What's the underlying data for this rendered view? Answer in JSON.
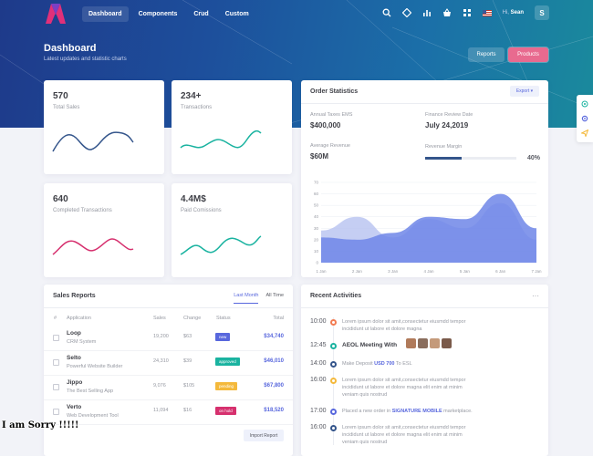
{
  "nav": {
    "items": [
      {
        "label": "Dashboard",
        "active": true
      },
      {
        "label": "Components",
        "active": false
      },
      {
        "label": "Crud",
        "active": false
      },
      {
        "label": "Custom",
        "active": false
      }
    ],
    "greeting": "Hi,",
    "user_name": "Sean",
    "user_initial": "S",
    "icons": [
      "search-icon",
      "diamond-icon",
      "bar-chart-icon",
      "basket-icon",
      "flag-icon"
    ]
  },
  "header": {
    "title": "Dashboard",
    "subtitle": "Latest updates and statistic charts",
    "reports_label": "Reports",
    "products_label": "Products"
  },
  "stats": [
    {
      "value": "570",
      "label": "Total Sales",
      "color": "#34558b"
    },
    {
      "value": "234+",
      "label": "Transactions",
      "color": "#1ab3a0"
    },
    {
      "value": "640",
      "label": "Completed Transactions",
      "color": "#d6306e"
    },
    {
      "value": "4.4M$",
      "label": "Paid Comissions",
      "color": "#1ab3a0"
    }
  ],
  "order_stats": {
    "title": "Order Statistics",
    "export_label": "Export",
    "annual_taxes_label": "Annual Taxes EMS",
    "annual_taxes_value": "$400,000",
    "finance_review_label": "Finance Review Date",
    "finance_review_value": "July 24,2019",
    "avg_revenue_label": "Average Revenue",
    "avg_revenue_value": "$60M",
    "revenue_margin_label": "Revenue Margin",
    "revenue_margin_value": "40%",
    "revenue_margin_fraction": 0.4
  },
  "chart_data": {
    "type": "area",
    "x": [
      "1 Jan",
      "2 Jan",
      "3 Jan",
      "4 Jan",
      "5 Jan",
      "6 Jan",
      "7 Jan"
    ],
    "yticks": [
      0,
      10,
      20,
      30,
      40,
      50,
      60,
      70
    ],
    "ylim": [
      0,
      70
    ],
    "series": [
      {
        "values": [
          28,
          40,
          22,
          38,
          30,
          52,
          20
        ],
        "color": "#b7c2f0"
      },
      {
        "values": [
          22,
          20,
          26,
          40,
          38,
          60,
          30
        ],
        "color": "#6f86e8"
      }
    ],
    "grid": true
  },
  "sales_reports": {
    "title": "Sales Reports",
    "tabs": [
      {
        "label": "Last Month",
        "active": true
      },
      {
        "label": "All Time",
        "active": false
      }
    ],
    "columns": [
      "#",
      "Application",
      "Sales",
      "Change",
      "Status",
      "Total"
    ],
    "rows": [
      {
        "name": "Loop",
        "desc": "CRM System",
        "sales": "19,200",
        "change": "$63",
        "status": "new",
        "status_color": "#5867dd",
        "total": "$34,740"
      },
      {
        "name": "Selto",
        "desc": "Powerful Website Builder",
        "sales": "24,310",
        "change": "$39",
        "status": "approved",
        "status_color": "#1ab3a0",
        "total": "$46,010"
      },
      {
        "name": "Jippo",
        "desc": "The Best Selling App",
        "sales": "9,076",
        "change": "$105",
        "status": "pending",
        "status_color": "#f4b93c",
        "total": "$67,800"
      },
      {
        "name": "Verto",
        "desc": "Web Development Tool",
        "sales": "11,094",
        "change": "$16",
        "status": "on hold",
        "status_color": "#d6306e",
        "total": "$18,520"
      }
    ],
    "import_label": "Import Report"
  },
  "activities": {
    "title": "Recent Activities",
    "items": [
      {
        "time": "10:00",
        "dot": "#f27c52",
        "text": "Lorem ipsum dolor sit amit,consectetur eiusmdd tempor incididunt ut labore et dolore magna"
      },
      {
        "time": "12:45",
        "dot": "#1ab3a0",
        "text": "AEOL Meeting With"
      },
      {
        "time": "14:00",
        "dot": "#34558b",
        "text_before": "Make Deposit ",
        "text_amount": "USD 700",
        "text_after": " To ESL"
      },
      {
        "time": "16:00",
        "dot": "#f4b93c",
        "text": "Lorem ipsum dolor sit amit,consectetur eiusmdd tempor incididunt ut labore et dolore magna elit enim at minim veniam quis nostrud"
      },
      {
        "time": "17:00",
        "dot": "#5867dd",
        "text_before": "Placed a new order in ",
        "text_amount": "SIGNATURE MOBILE",
        "text_after": " marketplace."
      },
      {
        "time": "16:00",
        "dot": "#34558b",
        "text": "Lorem ipsum dolor sit amit,consectetur eiusmdd tempor incididunt ut labore et dolore magna elit enim at minim veniam quis nostrud"
      }
    ]
  },
  "overlay_text": "I am Sorry !!!!!"
}
